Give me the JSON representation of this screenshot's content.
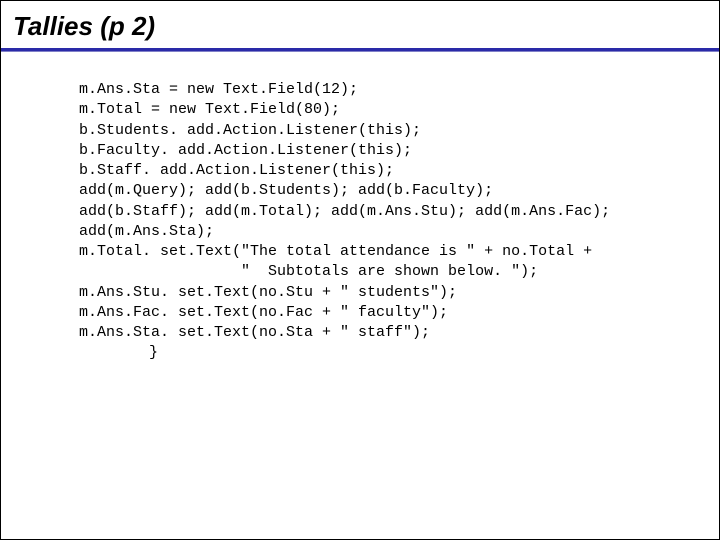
{
  "title": "Tallies (p 2)",
  "code": {
    "l01": "m.Ans.Sta = new Text.Field(12);",
    "l02": "m.Total = new Text.Field(80);",
    "l03": "b.Students. add.Action.Listener(this);",
    "l04": "b.Faculty. add.Action.Listener(this);",
    "l05": "b.Staff. add.Action.Listener(this);",
    "l06": "add(m.Query); add(b.Students); add(b.Faculty);",
    "l07": "add(b.Staff); add(m.Total); add(m.Ans.Stu); add(m.Ans.Fac);",
    "l08": "add(m.Ans.Sta);",
    "l09": "m.Total. set.Text(\"The total attendance is \" + no.Total +",
    "l10": "                  \"  Subtotals are shown below. \");",
    "l11": "m.Ans.Stu. set.Text(no.Stu + \" students\");",
    "l12": "m.Ans.Fac. set.Text(no.Fac + \" faculty\");",
    "l13": "m.Ans.Sta. set.Text(no.Sta + \" staff\");",
    "close": "}"
  }
}
